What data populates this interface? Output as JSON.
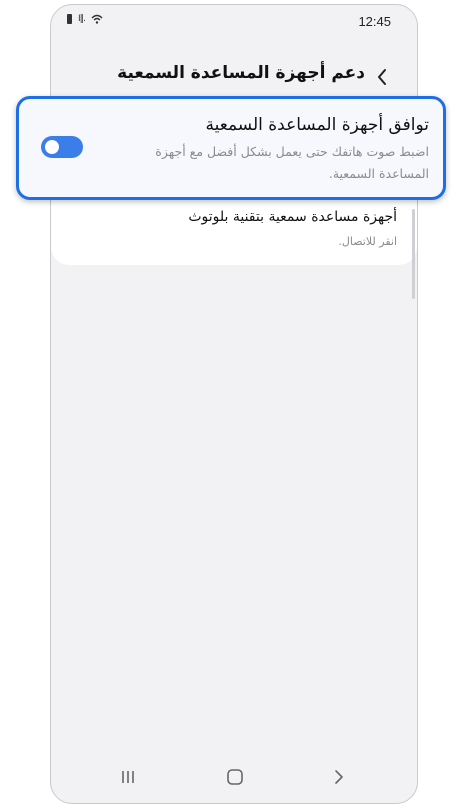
{
  "status_bar": {
    "time": "12:45",
    "icons": [
      "battery-icon",
      "signal-icon",
      "wifi-icon"
    ]
  },
  "header": {
    "title": "دعم أجهزة المساعدة السمعية",
    "back_icon": "chevron-left-icon"
  },
  "highlight_item": {
    "title": "توافق أجهزة المساعدة السمعية",
    "description": "اضبط صوت هاتفك حتى يعمل بشكل أفضل مع أجهزة المساعدة السمعية.",
    "toggle_state": "on",
    "accent_color": "#3b7ee9",
    "border_color": "#1e6fe6"
  },
  "bluetooth_item": {
    "title": "أجهزة مساعدة سمعية بتقنية بلوتوث",
    "subtitle": "انقر للاتصال."
  },
  "nav_bar": {
    "buttons": [
      "recent-apps-icon",
      "home-icon",
      "back-icon"
    ]
  }
}
